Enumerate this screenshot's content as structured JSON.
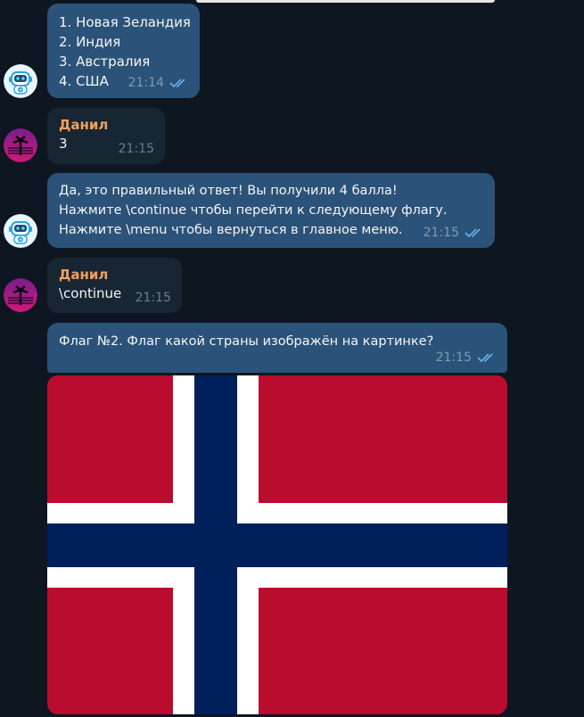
{
  "messages": {
    "m1": {
      "lines": [
        "1. Новая Зеландия",
        "2. Индия",
        "3. Австралия",
        "4. США"
      ],
      "time": "21:14"
    },
    "m2": {
      "sender": "Данил",
      "text": "3",
      "time": "21:15"
    },
    "m3": {
      "lines": [
        "Да, это правильный ответ! Вы получили 4 балла!",
        "Нажмите \\continue чтобы перейти к следующему флагу.",
        "Нажмите \\menu чтобы вернуться в главное меню."
      ],
      "time": "21:15"
    },
    "m4": {
      "sender": "Данил",
      "text": "\\continue",
      "time": "21:15"
    },
    "m5": {
      "text": "Флаг №2. Флаг какой страны изображён на картинке?",
      "time": "21:15"
    }
  },
  "colors": {
    "background": "#0e1621",
    "bot_bubble": "#2b5278",
    "user_bubble": "#182533",
    "sender_name": "#f2a05a",
    "flag_red": "#ba0c2f",
    "flag_blue": "#00205b"
  },
  "icons": {
    "read_receipt": "double-check-icon",
    "bot_avatar": "robot-icon",
    "user_avatar": "palm-sunset-icon"
  }
}
